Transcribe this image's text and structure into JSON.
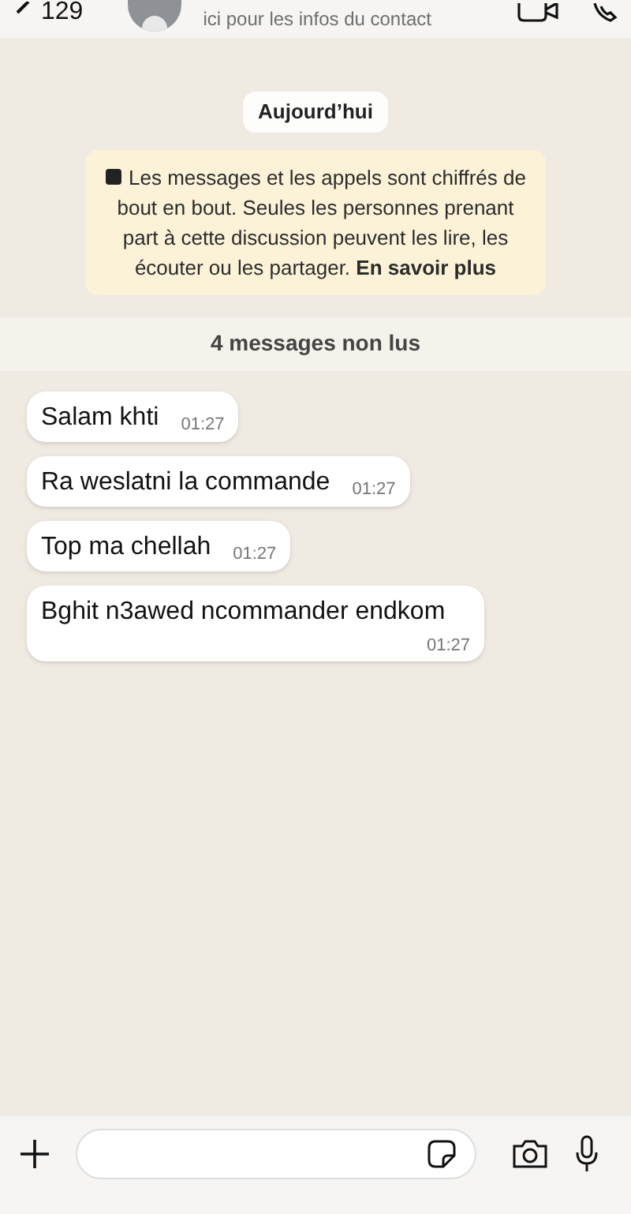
{
  "header": {
    "back_count": "129",
    "subtitle": "ici pour les infos du contact"
  },
  "date_pill": "Aujourd’hui",
  "encryption_notice": "Les messages et les appels sont chiffrés de bout en bout. Seules les personnes prenant part à cette discussion peuvent les lire, les écouter ou les partager. **En savoir plus**",
  "unread_banner": "4 messages non lus",
  "messages": [
    {
      "text": "Salam khti",
      "time": "01:27"
    },
    {
      "text": "Ra weslatni la commande",
      "time": "01:27"
    },
    {
      "text": "Top ma chellah",
      "time": "01:27"
    },
    {
      "text": "Bghit n3awed ncommander endkom",
      "time": "01:27"
    }
  ]
}
